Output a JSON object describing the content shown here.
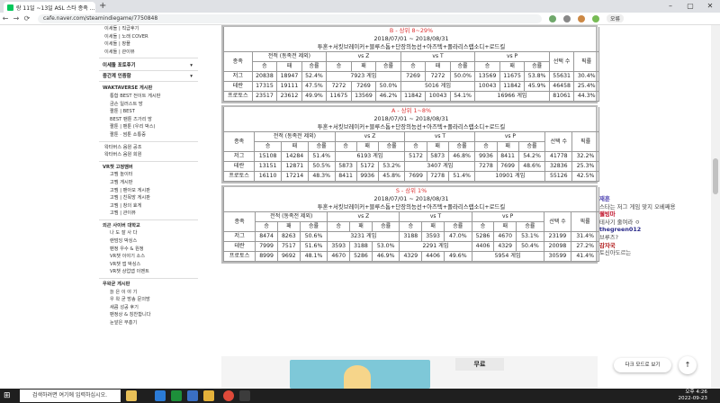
{
  "browser": {
    "tab_title": "랑 11일 ~13일 ASL 스타 종족 ...",
    "url": "cafe.naver.com/steamindiegame/7750848",
    "profile_badge": "오류"
  },
  "sidebar": {
    "items_top": [
      "이세돌 | 직급후기",
      "이세돌 | 노래 COVER",
      "이세돌 | 창플",
      "이세돌 | 관이뷰"
    ],
    "cat1": "이세돌 포토후기",
    "cat2": "중간계 인증함",
    "waktaverse_head": "WAKTAVERSE 게시판",
    "waktaverse_items": [
      "통합 BEST 전이트 게시판",
      "금손 일러스트 방",
      "짤툰 | BEST",
      "BEST 팬툰 즈가리 방",
      "짤툰 | 팬툰 (우리 박스)",
      "짤툰 · 썸툰 소통중"
    ],
    "wakbox_items": [
      "왁타버스 음원 공조",
      "왁타버스 음원 회원"
    ],
    "vr_head": "VR챗 고정멤버",
    "vr_items": [
      "고멤 놀이터",
      "고멤 게시판",
      "고멤 | 팬아모 게시판",
      "고멤 | 친목방 게시판",
      "고멤 | 창의 효게",
      "고멤 | 관이뷰"
    ],
    "outer_head": "외곤 사이버 대학교",
    "outer_items": [
      "나 도 잘 사 다",
      "랜덤잉 박싱스",
      "팬정 우수 & 원정",
      "VR챗 이야기 소스",
      "VR챗 앱 박싱스",
      "VR챗 상업앱 이벤트"
    ],
    "free_head": "우왁굳 게시판",
    "free_items": [
      "늙 은 이 야 기",
      "우 왁 굳 방송 문의방",
      "새콤 성공 후기",
      "팬정상 & 칭찬합니다",
      "눈앞은 부흥기"
    ]
  },
  "tables": [
    {
      "title": "B - 상위 8~29%",
      "period": "2018/07/01 ~ 2018/08/31",
      "maps": "투혼+서킷브레이커+블루스톰+단장의능선+아즈텍+폴라리스랩소디+로드킬",
      "head1": [
        "종족",
        "전적 (동족전 제외)",
        "vs Z",
        "vs T",
        "vs P",
        "선택 수",
        "픽률"
      ],
      "head2": [
        "승",
        "패",
        "승률",
        "승",
        "패",
        "승률",
        "승",
        "패",
        "승률",
        "승",
        "패",
        "승률"
      ],
      "rows": [
        {
          "race": "저그",
          "w": "20838",
          "l": "18947",
          "r": "52.4%",
          "vz": "7923 게임",
          "vt": [
            "7269",
            "7272",
            "50.0%"
          ],
          "vp": [
            "13569",
            "11675",
            "53.8%"
          ],
          "pick": "55631",
          "rate": "30.4%"
        },
        {
          "race": "테란",
          "w": "17315",
          "l": "19111",
          "r": "47.5%",
          "vz3": [
            "7272",
            "7269",
            "50.0%"
          ],
          "vt1": "5016 게임",
          "vp": [
            "10043",
            "11842",
            "45.9%"
          ],
          "pick": "46458",
          "rate": "25.4%"
        },
        {
          "race": "프로토스",
          "w": "23517",
          "l": "23612",
          "r": "49.9%",
          "vz3": [
            "11675",
            "13569",
            "46.2%"
          ],
          "vt": [
            "11842",
            "10043",
            "54.1%"
          ],
          "vp1": "16966 게임",
          "pick": "81061",
          "rate": "44.3%"
        }
      ]
    },
    {
      "title": "A - 상위 1~8%",
      "period": "2018/07/01 ~ 2018/08/31",
      "maps": "투혼+서킷브레이커+블루스톰+단장의능선+아즈텍+폴라리스랩소디+로드킬",
      "head1": [
        "종족",
        "전적 (동족전 제외)",
        "vs Z",
        "vs T",
        "vs P",
        "선택 수",
        "픽률"
      ],
      "head2": [
        "승",
        "패",
        "승률",
        "승",
        "패",
        "승률",
        "승",
        "패",
        "승률",
        "승",
        "패",
        "승률"
      ],
      "rows": [
        {
          "race": "저그",
          "w": "15108",
          "l": "14284",
          "r": "51.4%",
          "vz": "6193 게임",
          "vt": [
            "5172",
            "5873",
            "46.8%"
          ],
          "vp": [
            "9936",
            "8411",
            "54.2%"
          ],
          "pick": "41778",
          "rate": "32.2%"
        },
        {
          "race": "테란",
          "w": "13151",
          "l": "12871",
          "r": "50.5%",
          "vz3": [
            "5873",
            "5172",
            "53.2%"
          ],
          "vt1": "3407 게임",
          "vp": [
            "7278",
            "7699",
            "48.6%"
          ],
          "pick": "32836",
          "rate": "25.3%"
        },
        {
          "race": "프로토스",
          "w": "16110",
          "l": "17214",
          "r": "48.3%",
          "vz3": [
            "8411",
            "9936",
            "45.8%"
          ],
          "vt": [
            "7699",
            "7278",
            "51.4%"
          ],
          "vp1": "10901 게임",
          "pick": "55126",
          "rate": "42.5%"
        }
      ]
    },
    {
      "title": "S - 상위 1%",
      "period": "2018/07/01 ~ 2018/08/31",
      "maps": "투혼+서킷브레이커+블루스톰+단장의능선+아즈텍+폴라리스랩소디+로드킬",
      "head1": [
        "종족",
        "전적 (동족전 제외)",
        "vs Z",
        "vs T",
        "vs P",
        "선택 수",
        "픽률"
      ],
      "head2": [
        "승",
        "패",
        "승률",
        "승",
        "패",
        "승률",
        "승",
        "패",
        "승률",
        "승",
        "패",
        "승률"
      ],
      "rows": [
        {
          "race": "저그",
          "w": "8474",
          "l": "8263",
          "r": "50.6%",
          "vz": "3231 게임",
          "vt": [
            "3188",
            "3593",
            "47.0%"
          ],
          "vp": [
            "5286",
            "4670",
            "53.1%"
          ],
          "pick": "23199",
          "rate": "31.4%"
        },
        {
          "race": "테란",
          "w": "7999",
          "l": "7517",
          "r": "51.6%",
          "vz3": [
            "3593",
            "3188",
            "53.0%"
          ],
          "vt1": "2291 게임",
          "vp": [
            "4406",
            "4329",
            "50.4%"
          ],
          "pick": "20098",
          "rate": "27.2%"
        },
        {
          "race": "프로토스",
          "w": "8999",
          "l": "9692",
          "r": "48.1%",
          "vz3": [
            "4670",
            "5286",
            "46.9%"
          ],
          "vt": [
            "4329",
            "4406",
            "49.6%"
          ],
          "vp1": "5954 게임",
          "pick": "30599",
          "rate": "41.4%"
        }
      ]
    }
  ],
  "chat": [
    {
      "user": "재훈",
      "msg": "스타는 저그 게임 맞지 오베째용",
      "color": "#4a3fb0"
    },
    {
      "user": "웰빙마",
      "msg": "테사기 줄여라 ㅇ",
      "color": "#c0142c"
    },
    {
      "user": "thegreen012",
      "msg": "브루즈?",
      "color": "#2a2a8a"
    },
    {
      "user": "감자국",
      "msg": "토신아도르는",
      "color": "#b01919"
    }
  ],
  "banner": {
    "tag": "무료"
  },
  "darkmode_label": "다크 모드로 보기",
  "taskbar": {
    "search_placeholder": "검색하려면 여기에 입력하십시오.",
    "time": "오후 4:26",
    "date": "2022-09-23"
  }
}
